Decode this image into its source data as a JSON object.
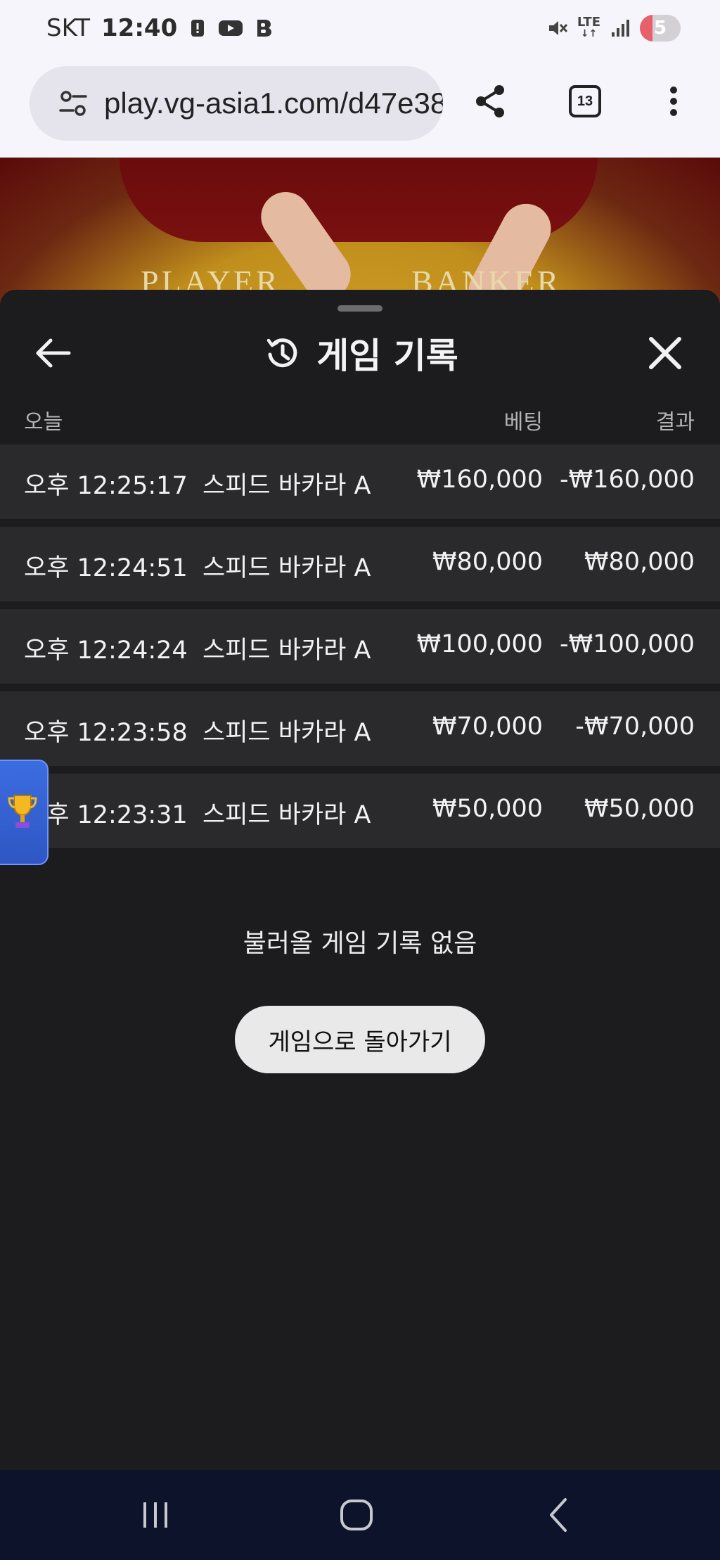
{
  "status_bar": {
    "carrier": "SKT",
    "time": "12:40",
    "network": "LTE",
    "battery_level": "5",
    "icons": [
      "alert-icon",
      "youtube-icon",
      "b-app-icon",
      "mute-icon",
      "lte-icon",
      "signal-icon",
      "battery-icon"
    ]
  },
  "browser": {
    "url": "play.vg-asia1.com/d47e38",
    "tab_count": "13",
    "icons": [
      "site-settings-icon",
      "share-icon",
      "tabs-icon",
      "more-vert-icon"
    ]
  },
  "video": {
    "player_label": "PLAYER",
    "banker_label": "BANKER"
  },
  "sheet": {
    "title": "게임 기록",
    "columns": {
      "date": "오늘",
      "bet": "베팅",
      "result": "결과"
    },
    "rows": [
      {
        "time": "오후 12:25:17",
        "game": "스피드 바카라 A",
        "bet": "₩160,000",
        "result": "-₩160,000"
      },
      {
        "time": "오후 12:24:51",
        "game": "스피드 바카라 A",
        "bet": "₩80,000",
        "result": "₩80,000"
      },
      {
        "time": "오후 12:24:24",
        "game": "스피드 바카라 A",
        "bet": "₩100,000",
        "result": "-₩100,000"
      },
      {
        "time": "오후 12:23:58",
        "game": "스피드 바카라 A",
        "bet": "₩70,000",
        "result": "-₩70,000"
      },
      {
        "time": "오후 12:23:31",
        "game": "스피드 바카라 A",
        "bet": "₩50,000",
        "result": "₩50,000"
      }
    ],
    "empty_message": "불러올 게임 기록 없음",
    "back_to_game_label": "게임으로 돌아가기"
  },
  "nav": {
    "icons": [
      "recent-apps-icon",
      "home-icon",
      "back-icon"
    ]
  },
  "colors": {
    "sheet_bg": "#1c1c1e",
    "row_bg": "#2a2a2c",
    "header_text": "#b4b4b8",
    "button_bg": "#e9e9ea",
    "nav_bg": "#0c132b",
    "trophy_tab": "#3b6de0"
  }
}
